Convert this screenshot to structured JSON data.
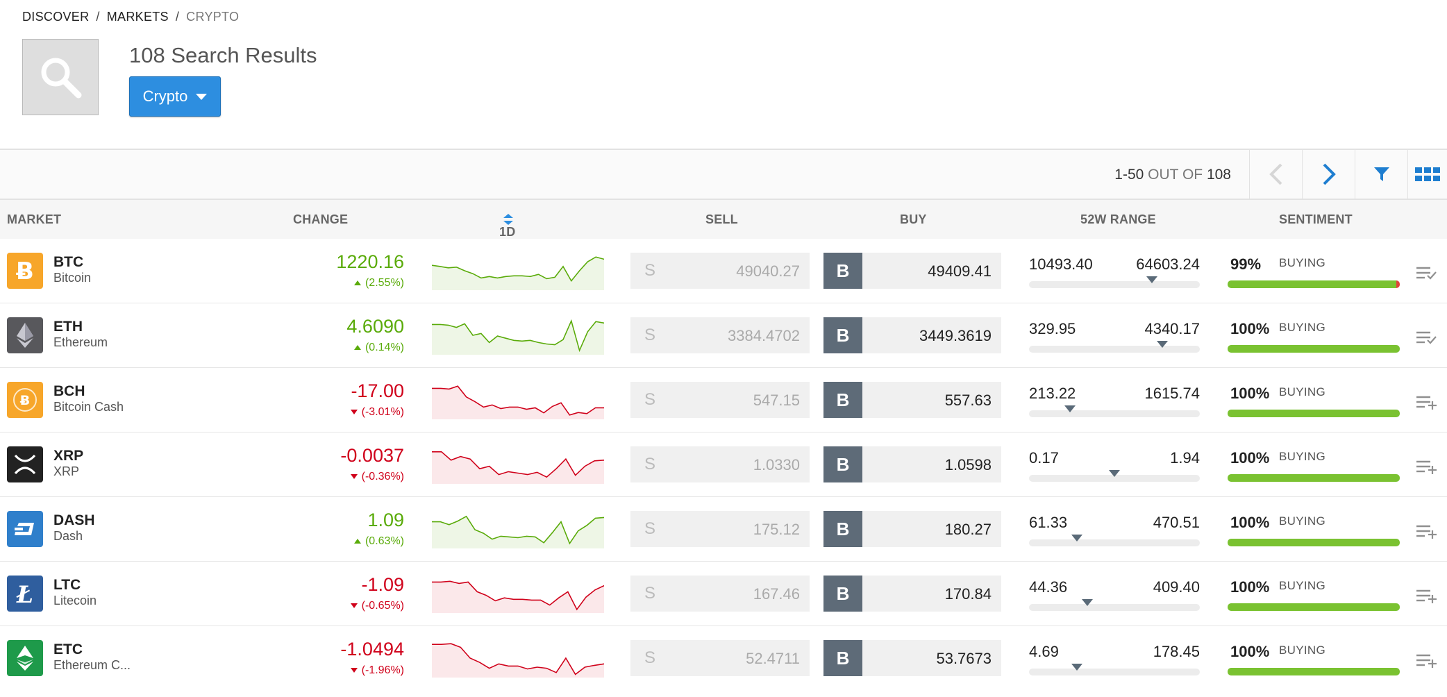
{
  "breadcrumb": [
    "DISCOVER",
    "MARKETS",
    "CRYPTO"
  ],
  "results_title": "108 Search Results",
  "filter_button": "Crypto",
  "pager": {
    "range": "1-50",
    "out_of": "OUT OF",
    "total": "108"
  },
  "columns": {
    "market": "MARKET",
    "change": "CHANGE",
    "period": "1D",
    "sell": "SELL",
    "buy": "BUY",
    "range_52w": "52W RANGE",
    "sentiment": "SENTIMENT"
  },
  "colors": {
    "up": "#5aab0a",
    "down": "#d0021b",
    "accent": "#2d8ee0",
    "sentiment_bar": "#7ac231"
  },
  "rows": [
    {
      "symbol": "BTC",
      "name": "Bitcoin",
      "icon": "bitcoin-icon",
      "logo_color": "#f7a62a",
      "change": "1220.16",
      "change_pct": "(2.55%)",
      "direction": "up",
      "sell_label": "S",
      "sell": "49040.27",
      "buy_label": "B",
      "buy_main": "49409",
      "buy_frac": ".41",
      "range_low": "10493.40",
      "range_high": "64603.24",
      "range_pos": 0.72,
      "sentiment_pct": "99%",
      "sentiment_label": "BUYING",
      "action_icon": "list-check-icon",
      "spark": [
        0.35,
        0.38,
        0.42,
        0.4,
        0.5,
        0.58,
        0.7,
        0.66,
        0.7,
        0.66,
        0.64,
        0.64,
        0.66,
        0.6,
        0.72,
        0.68,
        0.38,
        0.78,
        0.5,
        0.25,
        0.12,
        0.18
      ]
    },
    {
      "symbol": "ETH",
      "name": "Ethereum",
      "icon": "ethereum-icon",
      "logo_color": "#58585c",
      "change": "4.6090",
      "change_pct": "(0.14%)",
      "direction": "up",
      "sell_label": "S",
      "sell": "3384.4702",
      "buy_label": "B",
      "buy_main": "3449",
      "buy_frac": ".3619",
      "range_low": "329.95",
      "range_high": "4340.17",
      "range_pos": 0.78,
      "sentiment_pct": "100%",
      "sentiment_label": "BUYING",
      "action_icon": "list-check-icon",
      "spark": [
        0.2,
        0.2,
        0.22,
        0.28,
        0.18,
        0.5,
        0.45,
        0.7,
        0.52,
        0.58,
        0.64,
        0.66,
        0.64,
        0.7,
        0.74,
        0.76,
        0.62,
        0.1,
        0.92,
        0.4,
        0.12,
        0.16
      ]
    },
    {
      "symbol": "BCH",
      "name": "Bitcoin Cash",
      "icon": "bitcoin-cash-icon",
      "logo_color": "#f7a62a",
      "change": "-17.00",
      "change_pct": "(-3.01%)",
      "direction": "down",
      "sell_label": "S",
      "sell": "547.15",
      "buy_label": "B",
      "buy_main": "557",
      "buy_frac": ".63",
      "range_low": "213.22",
      "range_high": "1615.74",
      "range_pos": 0.24,
      "sentiment_pct": "100%",
      "sentiment_label": "BUYING",
      "action_icon": "list-add-icon",
      "spark": [
        0.18,
        0.18,
        0.2,
        0.12,
        0.42,
        0.55,
        0.7,
        0.64,
        0.74,
        0.7,
        0.7,
        0.76,
        0.72,
        0.86,
        0.68,
        0.58,
        0.92,
        0.85,
        0.88,
        0.72,
        0.72
      ]
    },
    {
      "symbol": "XRP",
      "name": "XRP",
      "icon": "xrp-icon",
      "logo_color": "#222222",
      "change": "-0.0037",
      "change_pct": "(-0.36%)",
      "direction": "down",
      "sell_label": "S",
      "sell": "1.0330",
      "buy_label": "B",
      "buy_main": "1",
      "buy_frac": ".0598",
      "range_low": "0.17",
      "range_high": "1.94",
      "range_pos": 0.5,
      "sentiment_pct": "100%",
      "sentiment_label": "BUYING",
      "action_icon": "list-add-icon",
      "spark": [
        0.15,
        0.15,
        0.38,
        0.28,
        0.35,
        0.62,
        0.55,
        0.78,
        0.7,
        0.74,
        0.78,
        0.72,
        0.85,
        0.62,
        0.35,
        0.8,
        0.55,
        0.4,
        0.38
      ]
    },
    {
      "symbol": "DASH",
      "name": "Dash",
      "icon": "dash-icon",
      "logo_color": "#2f7fcb",
      "change": "1.09",
      "change_pct": "(0.63%)",
      "direction": "up",
      "sell_label": "S",
      "sell": "175.12",
      "buy_label": "B",
      "buy_main": "180",
      "buy_frac": ".27",
      "range_low": "61.33",
      "range_high": "470.51",
      "range_pos": 0.28,
      "sentiment_pct": "100%",
      "sentiment_label": "BUYING",
      "action_icon": "list-add-icon",
      "spark": [
        0.3,
        0.3,
        0.38,
        0.28,
        0.15,
        0.52,
        0.62,
        0.78,
        0.7,
        0.72,
        0.74,
        0.7,
        0.72,
        0.88,
        0.6,
        0.3,
        0.9,
        0.55,
        0.4,
        0.2,
        0.18
      ]
    },
    {
      "symbol": "LTC",
      "name": "Litecoin",
      "icon": "litecoin-icon",
      "logo_color": "#2f5e9e",
      "change": "-1.09",
      "change_pct": "(-0.65%)",
      "direction": "down",
      "sell_label": "S",
      "sell": "167.46",
      "buy_label": "B",
      "buy_main": "170",
      "buy_frac": ".84",
      "range_low": "44.36",
      "range_high": "409.40",
      "range_pos": 0.34,
      "sentiment_pct": "100%",
      "sentiment_label": "BUYING",
      "action_icon": "list-add-icon",
      "spark": [
        0.18,
        0.18,
        0.16,
        0.22,
        0.18,
        0.45,
        0.55,
        0.7,
        0.62,
        0.66,
        0.66,
        0.68,
        0.68,
        0.82,
        0.62,
        0.45,
        0.94,
        0.6,
        0.4,
        0.28
      ]
    },
    {
      "symbol": "ETC",
      "name": "Ethereum C...",
      "icon": "ethereum-classic-icon",
      "logo_color": "#1e9a4a",
      "change": "-1.0494",
      "change_pct": "(-1.96%)",
      "direction": "down",
      "sell_label": "S",
      "sell": "52.4711",
      "buy_label": "B",
      "buy_main": "53",
      "buy_frac": ".7673",
      "range_low": "4.69",
      "range_high": "178.45",
      "range_pos": 0.28,
      "sentiment_pct": "100%",
      "sentiment_label": "BUYING",
      "action_icon": "list-add-icon",
      "spark": [
        0.12,
        0.12,
        0.1,
        0.2,
        0.5,
        0.62,
        0.78,
        0.66,
        0.72,
        0.72,
        0.8,
        0.75,
        0.78,
        0.9,
        0.5,
        0.95,
        0.75,
        0.7,
        0.66
      ]
    }
  ]
}
